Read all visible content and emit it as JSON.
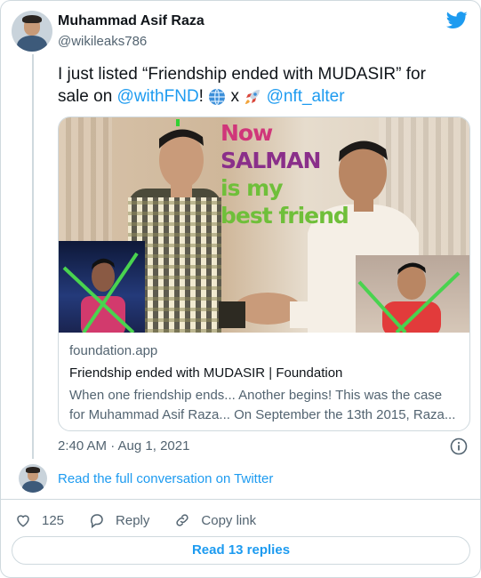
{
  "author": {
    "name": "Muhammad Asif Raza",
    "handle": "@wikileaks786"
  },
  "tweet": {
    "text_part1": "I just listed “Friendship ended with MUDASIR” for sale on ",
    "mention1": "@withFND",
    "text_part2": "! ",
    "emoji1": "globe-icon",
    "text_x": " x ",
    "emoji2": "rocket-icon",
    "mention2": "@nft_alter"
  },
  "preview": {
    "meme_lines": [
      "Now",
      "SALMAN",
      "is my",
      "best friend"
    ],
    "domain": "foundation.app",
    "title": "Friendship ended with MUDASIR | Foundation",
    "description": "When one friendship ends... Another begins! This was the case for Muhammad Asif Raza... On September the 13th 2015, Raza..."
  },
  "meta": {
    "timestamp": "2:40 AM · Aug 1, 2021"
  },
  "conversation_link": "Read the full conversation on Twitter",
  "actions": {
    "like_count": "125",
    "reply_label": "Reply",
    "copy_label": "Copy link"
  },
  "read_replies": "Read 13 replies",
  "colors": {
    "link": "#1d9bf0",
    "meme_now": "#d0367a",
    "meme_salman": "#8a2f8a",
    "meme_green": "#6fbf3a"
  }
}
